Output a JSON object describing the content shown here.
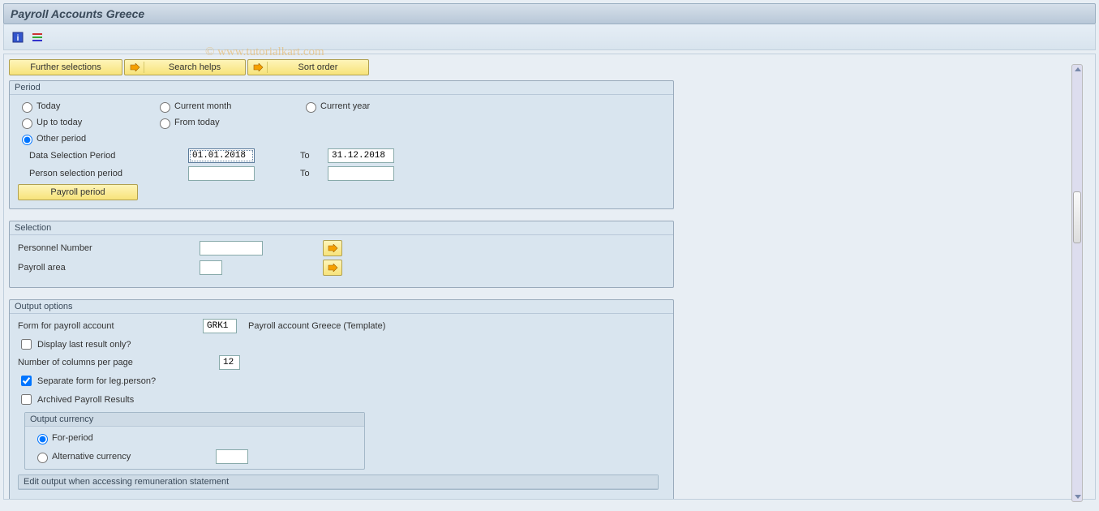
{
  "header": {
    "title": "Payroll Accounts Greece"
  },
  "watermark": "© www.tutorialkart.com",
  "action_bar": {
    "further_selections": "Further selections",
    "search_helps": "Search helps",
    "sort_order": "Sort order"
  },
  "period_panel": {
    "title": "Period",
    "radios": {
      "today": "Today",
      "current_month": "Current month",
      "current_year": "Current year",
      "up_to_today": "Up to today",
      "from_today": "From today",
      "other_period": "Other period",
      "selected": "other_period"
    },
    "data_selection_label": "Data Selection Period",
    "data_selection_from": "01.01.2018",
    "data_selection_to_label": "To",
    "data_selection_to": "31.12.2018",
    "person_selection_label": "Person selection period",
    "person_selection_from": "",
    "person_selection_to_label": "To",
    "person_selection_to": "",
    "payroll_period_btn": "Payroll period"
  },
  "selection_panel": {
    "title": "Selection",
    "personnel_number_label": "Personnel Number",
    "personnel_number_value": "",
    "payroll_area_label": "Payroll area",
    "payroll_area_value": ""
  },
  "output_panel": {
    "title": "Output options",
    "form_label": "Form for payroll account",
    "form_code": "GRK1",
    "form_desc": "Payroll account Greece (Template)",
    "display_last_label": "Display last result only?",
    "display_last_checked": false,
    "cols_label": "Number of columns per page",
    "cols_value": "12",
    "sep_form_label": "Separate form for leg.person?",
    "sep_form_checked": true,
    "archived_label": "Archived Payroll Results",
    "archived_checked": false,
    "currency_sub": {
      "title": "Output currency",
      "for_period": "For-period",
      "alt_currency": "Alternative currency",
      "alt_value": "",
      "selected": "for_period"
    },
    "edit_sub": {
      "title": "Edit output when accessing remuneration statement"
    }
  }
}
